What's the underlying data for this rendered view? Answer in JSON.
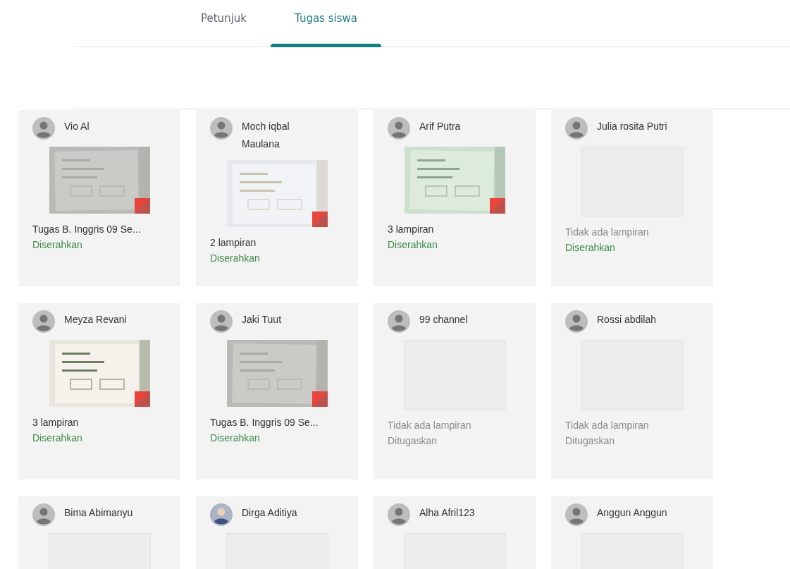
{
  "tabs": [
    {
      "label": "Petunjuk",
      "selected": false
    },
    {
      "label": "Tugas siswa",
      "selected": true
    }
  ],
  "submissions": [
    {
      "name": "Vio Al",
      "photo_avatar": false,
      "kind": "picture",
      "attachment": "Tugas B. Inggris 09 Se...",
      "no_attachment": false,
      "status": "Diserahkan",
      "submitted": true
    },
    {
      "name": "Moch iqbal Maulana",
      "photo_avatar": false,
      "kind": "picture",
      "attachment": "2 lampiran",
      "no_attachment": false,
      "status": "Diserahkan",
      "submitted": true
    },
    {
      "name": "Arif Putra",
      "photo_avatar": false,
      "kind": "picture",
      "attachment": "3 lampiran",
      "no_attachment": false,
      "status": "Diserahkan",
      "submitted": true
    },
    {
      "name": "Julia rosita Putri",
      "photo_avatar": false,
      "kind": "empty",
      "attachment": "Tidak ada lampiran",
      "no_attachment": true,
      "status": "Diserahkan",
      "submitted": true
    },
    {
      "name": "Meyza Revani",
      "photo_avatar": false,
      "kind": "picture",
      "attachment": "3 lampiran",
      "no_attachment": false,
      "status": "Diserahkan",
      "submitted": true
    },
    {
      "name": "Jaki Tuut",
      "photo_avatar": false,
      "kind": "picture",
      "attachment": "Tugas B. Inggris 09 Se...",
      "no_attachment": false,
      "status": "Diserahkan",
      "submitted": true
    },
    {
      "name": "99 channel",
      "photo_avatar": false,
      "kind": "empty",
      "attachment": "Tidak ada lampiran",
      "no_attachment": true,
      "status": "Ditugaskan",
      "submitted": false
    },
    {
      "name": "Rossi abdilah",
      "photo_avatar": false,
      "kind": "empty",
      "attachment": "Tidak ada lampiran",
      "no_attachment": true,
      "status": "Ditugaskan",
      "submitted": false
    },
    {
      "name": "Bima Abimanyu",
      "photo_avatar": false,
      "kind": "empty"
    },
    {
      "name": "Dirga Aditiya",
      "photo_avatar": true,
      "kind": "empty"
    },
    {
      "name": "Alha Afril123",
      "photo_avatar": false,
      "kind": "empty"
    },
    {
      "name": "Anggun Anggun",
      "photo_avatar": false,
      "kind": "empty"
    }
  ]
}
